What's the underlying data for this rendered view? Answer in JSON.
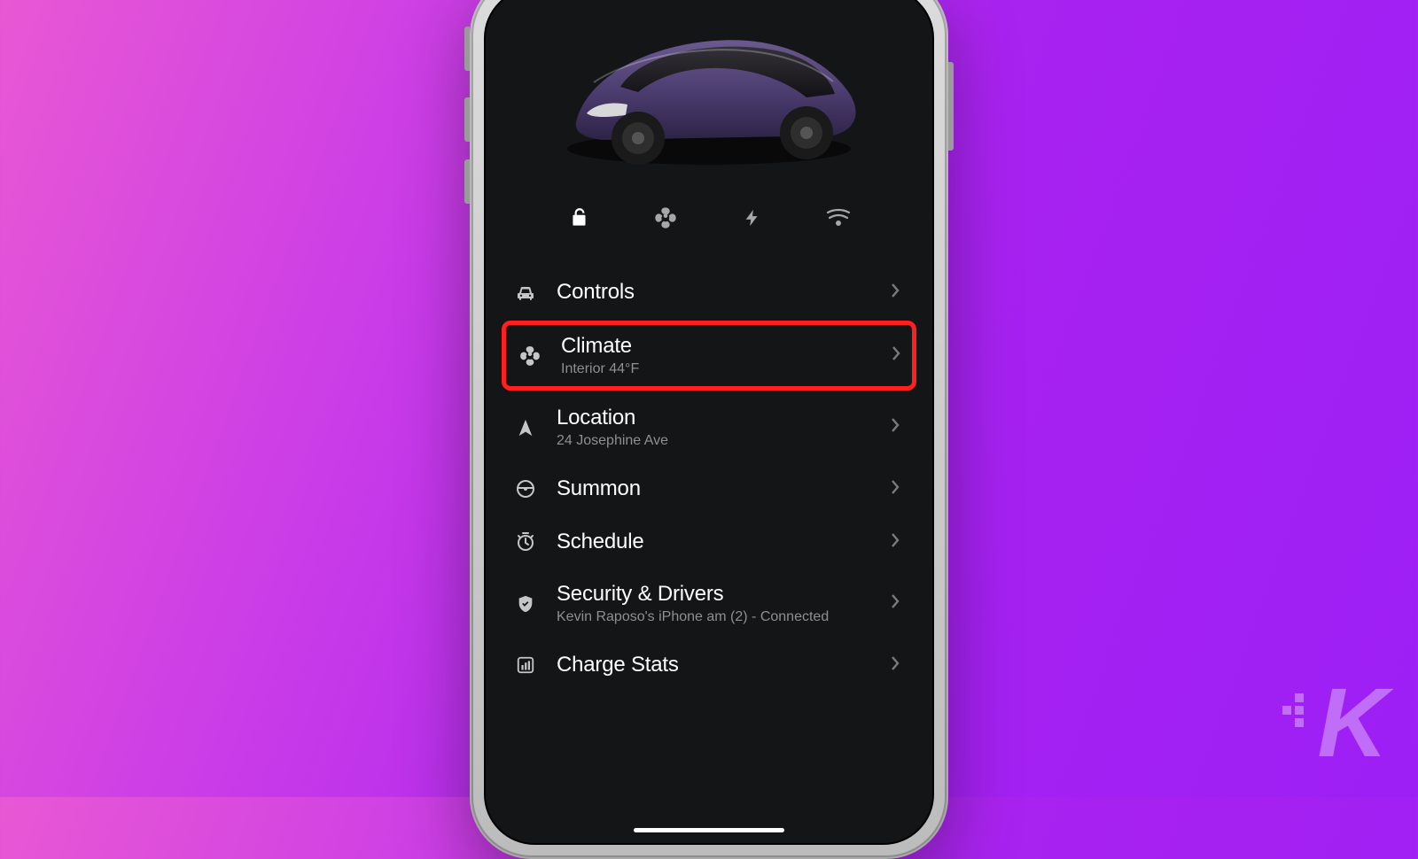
{
  "quick_actions": {
    "lock": {
      "name": "unlock-icon"
    },
    "fan": {
      "name": "fan-icon"
    },
    "bolt": {
      "name": "bolt-icon"
    },
    "port": {
      "name": "charge-port-icon"
    }
  },
  "menu": {
    "controls": {
      "title": "Controls"
    },
    "climate": {
      "title": "Climate",
      "sub": "Interior 44°F",
      "highlighted": true
    },
    "location": {
      "title": "Location",
      "sub": "24 Josephine Ave"
    },
    "summon": {
      "title": "Summon"
    },
    "schedule": {
      "title": "Schedule"
    },
    "security": {
      "title": "Security & Drivers",
      "sub": "Kevin Raposo's iPhone am (2) - Connected"
    },
    "charge": {
      "title": "Charge Stats"
    }
  },
  "watermark": "K"
}
